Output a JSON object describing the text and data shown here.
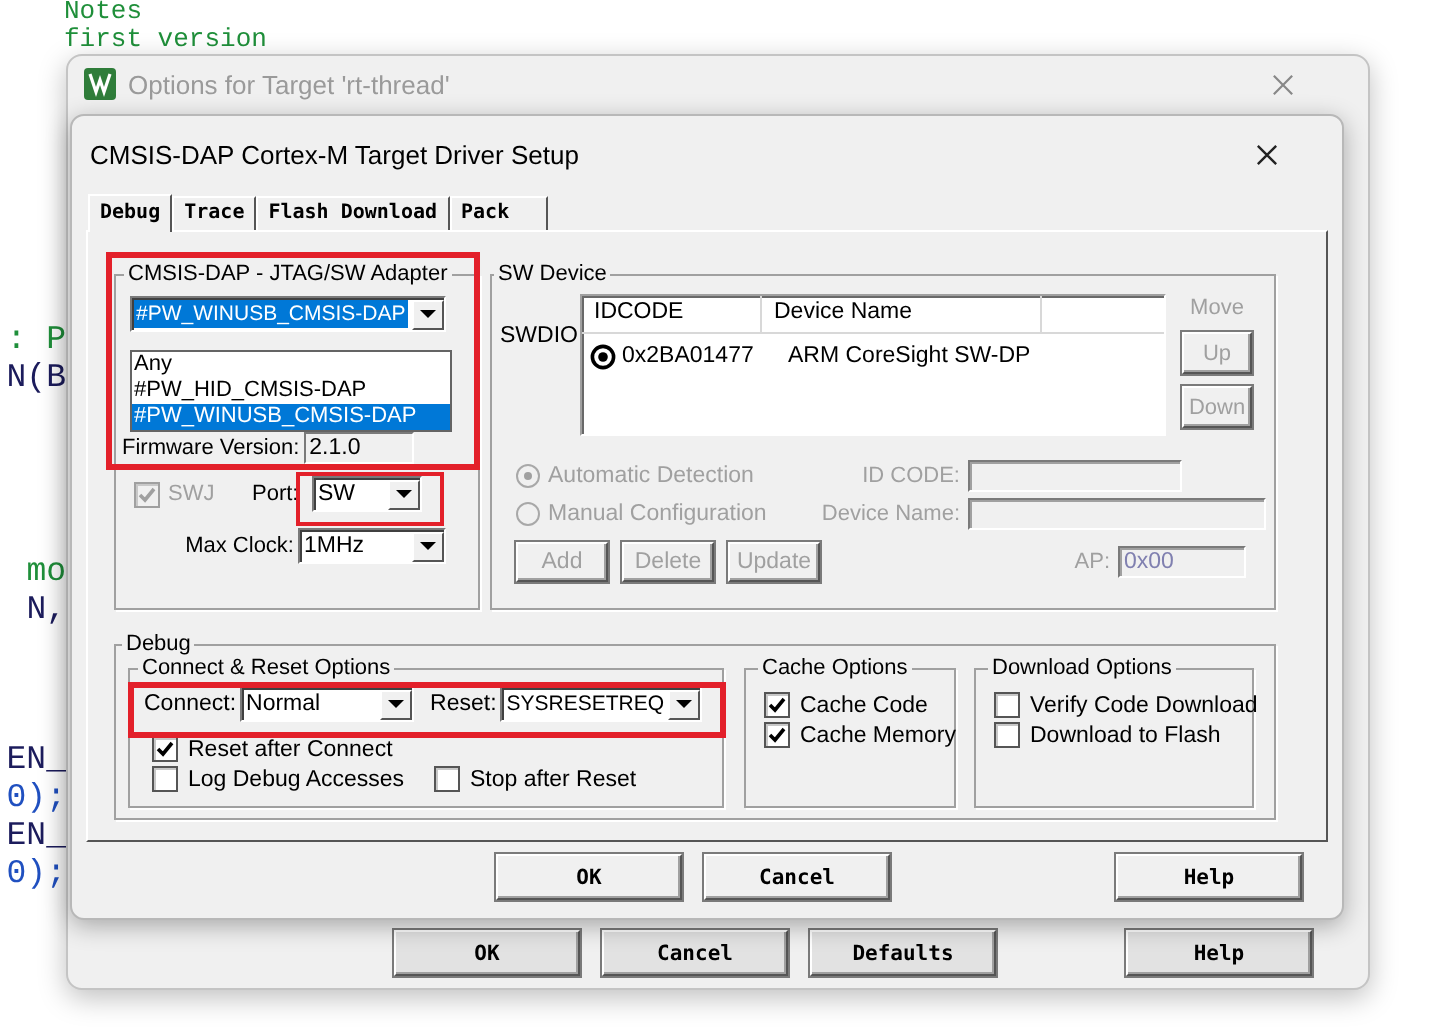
{
  "editor": {
    "top_lines": [
      {
        "text": "Notes",
        "color": "#1f8f3a"
      },
      {
        "text": "first version",
        "color": "#1f8f3a"
      }
    ],
    "side_fragments": [
      {
        "text": ": P",
        "color": "#1f8f3a"
      },
      {
        "text": "N(B",
        "color": "#1c1c5c"
      },
      {
        "text": "mo",
        "color": "#1f8f3a"
      },
      {
        "text": "N,",
        "color": "#1c1c5c"
      },
      {
        "text": "EN_",
        "color": "#1c1c5c"
      },
      {
        "text": "0);",
        "color": "#2050c0"
      },
      {
        "text": "EN_",
        "color": "#1c1c5c"
      },
      {
        "text": "0);",
        "color": "#2050c0"
      }
    ]
  },
  "window": {
    "title": "Options for Target 'rt-thread'",
    "buttons": [
      {
        "label": "OK"
      },
      {
        "label": "Cancel"
      },
      {
        "label": "Defaults"
      },
      {
        "label": "Help"
      }
    ]
  },
  "dialog": {
    "title": "CMSIS-DAP Cortex-M Target Driver Setup",
    "tabs": [
      {
        "label": "Debug",
        "selected": true
      },
      {
        "label": "Trace",
        "selected": false
      },
      {
        "label": "Flash Download",
        "selected": false
      },
      {
        "label": "Pack",
        "selected": false
      }
    ],
    "adapter": {
      "legend": "CMSIS-DAP - JTAG/SW Adapter",
      "value": "#PW_WINUSB_CMSIS-DAP",
      "options": [
        {
          "label": "Any",
          "selected": false
        },
        {
          "label": "#PW_HID_CMSIS-DAP",
          "selected": false
        },
        {
          "label": "#PW_WINUSB_CMSIS-DAP",
          "selected": true
        }
      ],
      "firmware_label": "Firmware Version:",
      "firmware_value": "2.1.0",
      "swj": {
        "label": "SWJ",
        "checked": true,
        "disabled": true
      },
      "port": {
        "label": "Port:",
        "value": "SW"
      },
      "max_clock": {
        "label": "Max Clock:",
        "value": "1MHz"
      }
    },
    "sw_device": {
      "legend": "SW Device",
      "row_label": "SWDIO",
      "columns": [
        "IDCODE",
        "Device Name"
      ],
      "rows": [
        {
          "idcode": "0x2BA01477",
          "device_name": "ARM CoreSight SW-DP",
          "selected": true
        }
      ],
      "move_label": "Move",
      "move_buttons": [
        {
          "label": "Up",
          "disabled": true
        },
        {
          "label": "Down",
          "disabled": true
        }
      ],
      "detection": [
        {
          "label": "Automatic Detection",
          "selected": true,
          "disabled": true
        },
        {
          "label": "Manual Configuration",
          "selected": false,
          "disabled": true
        }
      ],
      "id_code_label": "ID CODE:",
      "device_name_label": "Device Name:",
      "actions": [
        {
          "label": "Add",
          "disabled": true
        },
        {
          "label": "Delete",
          "disabled": true
        },
        {
          "label": "Update",
          "disabled": true
        }
      ],
      "ap_label": "AP:",
      "ap_value": "0x00"
    },
    "debug": {
      "legend": "Debug",
      "connect_reset": {
        "legend": "Connect & Reset Options",
        "connect_label": "Connect:",
        "connect_value": "Normal",
        "reset_label": "Reset:",
        "reset_value": "SYSRESETREQ",
        "options": [
          {
            "label": "Reset after Connect",
            "checked": true
          },
          {
            "label": "Log Debug Accesses",
            "checked": false
          },
          {
            "label": "Stop after Reset",
            "checked": false
          }
        ]
      },
      "cache": {
        "legend": "Cache Options",
        "options": [
          {
            "label": "Cache Code",
            "checked": true
          },
          {
            "label": "Cache Memory",
            "checked": true
          }
        ]
      },
      "download": {
        "legend": "Download Options",
        "options": [
          {
            "label": "Verify Code Download",
            "checked": false
          },
          {
            "label": "Download to Flash",
            "checked": false
          }
        ]
      }
    },
    "buttons": [
      {
        "label": "OK"
      },
      {
        "label": "Cancel"
      },
      {
        "label": "Help"
      }
    ]
  }
}
